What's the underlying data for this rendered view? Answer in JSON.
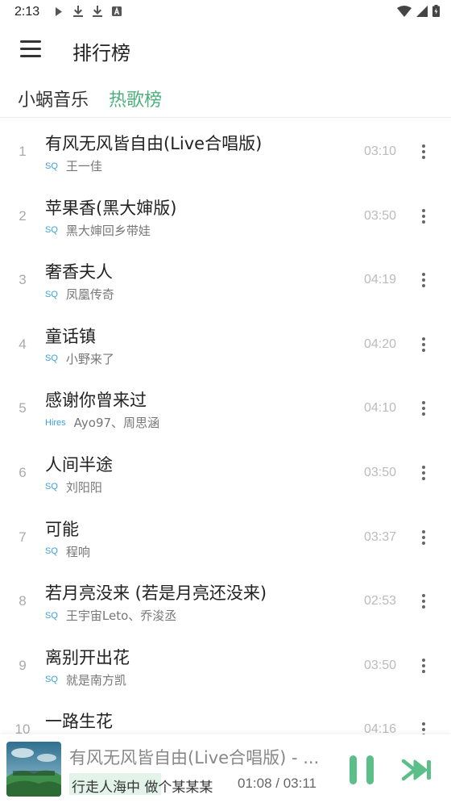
{
  "status_bar": {
    "time": "2:13"
  },
  "header": {
    "title": "排行榜"
  },
  "tabs": [
    {
      "label": "小蜗音乐"
    },
    {
      "label": "热歌榜"
    }
  ],
  "accent_color": "#4caf7d",
  "songs": [
    {
      "rank": "1",
      "title": "有风无风皆自由(Live合唱版)",
      "quality": "SQ",
      "artist": "王一佳",
      "duration": "03:10"
    },
    {
      "rank": "2",
      "title": "苹果香(黑大婶版)",
      "quality": "SQ",
      "artist": "黑大婶回乡带娃",
      "duration": "03:50"
    },
    {
      "rank": "3",
      "title": "奢香夫人",
      "quality": "SQ",
      "artist": "凤凰传奇",
      "duration": "04:19"
    },
    {
      "rank": "4",
      "title": "童话镇",
      "quality": "SQ",
      "artist": "小野来了",
      "duration": "04:20"
    },
    {
      "rank": "5",
      "title": "感谢你曾来过",
      "quality": "Hires",
      "artist": "Ayo97、周思涵",
      "duration": "04:10"
    },
    {
      "rank": "6",
      "title": "人间半途",
      "quality": "SQ",
      "artist": "刘阳阳",
      "duration": "03:50"
    },
    {
      "rank": "7",
      "title": "可能",
      "quality": "SQ",
      "artist": "程响",
      "duration": "03:37"
    },
    {
      "rank": "8",
      "title": "若月亮没来 (若是月亮还没来)",
      "quality": "SQ",
      "artist": "王宇宙Leto、乔浚丞",
      "duration": "02:53"
    },
    {
      "rank": "9",
      "title": "离别开出花",
      "quality": "SQ",
      "artist": "就是南方凯",
      "duration": "03:50"
    },
    {
      "rank": "10",
      "title": "一路生花",
      "quality": "",
      "artist": "",
      "duration": "04:16"
    }
  ],
  "player": {
    "now_playing": "有风无风皆自由(Live合唱版) - ...",
    "lyric": "行走人海中 做个某某某",
    "time": "01:08 / 03:11",
    "progress": 0.355,
    "cover_icon": "album-cover"
  }
}
